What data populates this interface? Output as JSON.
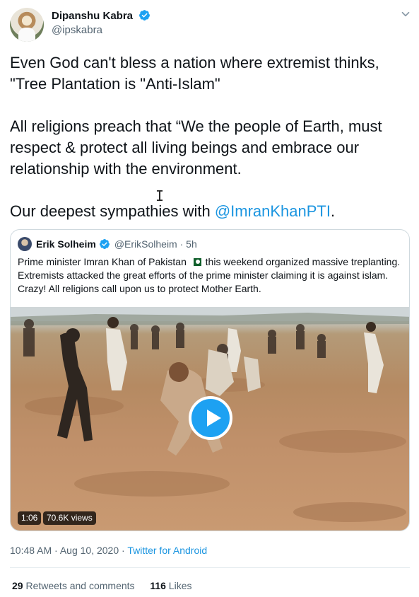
{
  "tweet": {
    "author_name": "Dipanshu Kabra",
    "author_handle": "@ipskabra",
    "line1": "Even God can't bless a nation where extremist thinks,",
    "line2": "\"Tree Plantation is \"Anti-Islam\"",
    "para2": "All religions preach that “We the people of Earth, must respect & protect all living beings and embrace our relationship with the environment.",
    "para3_prefix": "Our deepest sympathies with ",
    "para3_mention": "@ImranKhanPTI",
    "para3_suffix": "."
  },
  "quoted": {
    "name": "Erik Solheim",
    "handle_time": "@ErikSolheim · 5h",
    "text_part1": "Prime minister Imran Khan of Pakistan ",
    "text_part2": " this weekend organized massive treplanting.  Extremists attacked the great efforts of the prime minister claiming it is against islam. Crazy! All religions call upon us to protect Mother Earth.",
    "video_duration": "1:06",
    "video_views": "70.6K views"
  },
  "meta": {
    "timestamp": "10:48 AM · Aug 10, 2020 · ",
    "source": "Twitter for Android"
  },
  "stats": {
    "retweets_count": "29",
    "retweets_label": " Retweets and comments",
    "likes_count": "116",
    "likes_label": " Likes"
  },
  "icons": {
    "verified": "verified-badge-icon",
    "caret": "chevron-down-icon",
    "play": "play-icon",
    "flag": "pakistan-flag-icon"
  },
  "colors": {
    "accent": "#1da1f2",
    "link": "#1b95e0",
    "secondary_text": "#536471"
  }
}
